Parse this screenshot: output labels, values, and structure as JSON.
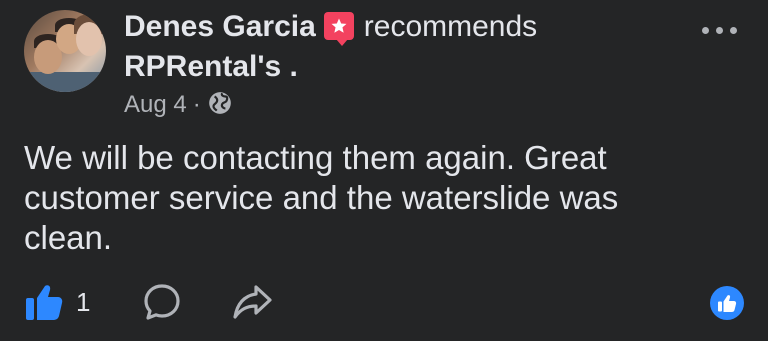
{
  "post": {
    "author_name": "Denes Garcia",
    "action_text": "recommends",
    "page_name": "RPRental's .",
    "date": "Aug 4",
    "separator": "·",
    "body": "We will be contacting them again. Great customer service and the waterslide was clean.",
    "like_count": "1"
  },
  "icons": {
    "badge": "recommend-star-icon",
    "privacy": "globe-icon",
    "more": "more-options-icon",
    "like": "thumbs-up-icon",
    "comment": "comment-icon",
    "share": "share-icon",
    "reaction": "like-reaction-icon"
  },
  "colors": {
    "background": "#242526",
    "text": "#e4e6eb",
    "secondary_text": "#b0b3b8",
    "recommend_badge": "#f3425f",
    "like_blue": "#2d88ff"
  }
}
